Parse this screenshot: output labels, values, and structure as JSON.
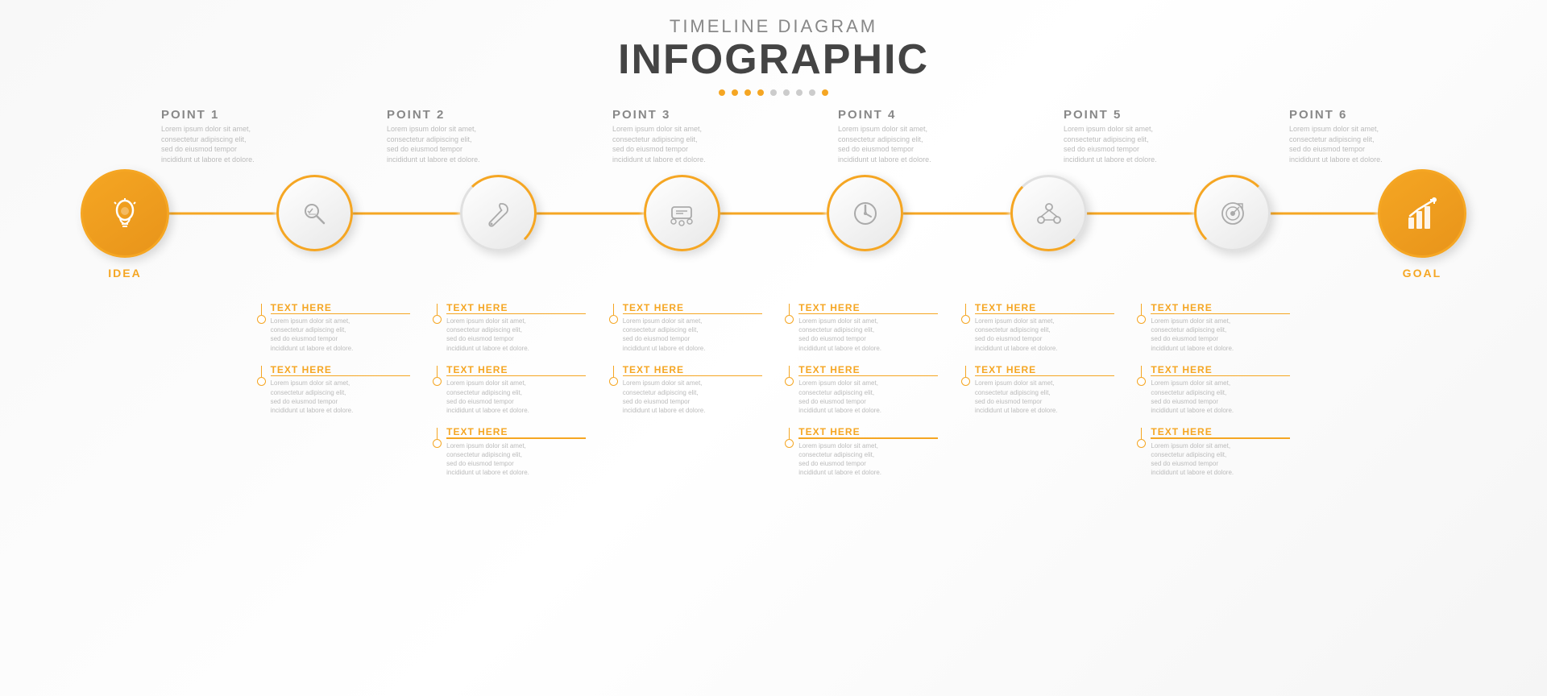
{
  "header": {
    "subtitle": "Timeline Diagram",
    "title": "INFOGRAPHIC",
    "dots": [
      {
        "type": "orange"
      },
      {
        "type": "orange"
      },
      {
        "type": "orange"
      },
      {
        "type": "orange"
      },
      {
        "type": "gray"
      },
      {
        "type": "gray"
      },
      {
        "type": "gray"
      },
      {
        "type": "gray"
      },
      {
        "type": "orange"
      }
    ]
  },
  "nodes": [
    {
      "id": "idea",
      "label": "IDEA",
      "type": "start"
    },
    {
      "id": "point1",
      "label": "POINT 1",
      "type": "mid"
    },
    {
      "id": "point2",
      "label": "POINT 2",
      "type": "mid"
    },
    {
      "id": "point3",
      "label": "POINT 3",
      "type": "mid"
    },
    {
      "id": "point4",
      "label": "POINT 4",
      "type": "mid"
    },
    {
      "id": "point5",
      "label": "POINT 5",
      "type": "mid"
    },
    {
      "id": "point6",
      "label": "POINT 6",
      "type": "mid"
    },
    {
      "id": "goal",
      "label": "GOAL",
      "type": "end"
    }
  ],
  "lorem": "Lorem ipsum dolor sit amet, consectetur adipiscing elit, sed do eiusmod tempor incididunt ut labore et dolore.",
  "lorem_short": "Lorem ipsum dolor sit amet, consectetur adipiscing elit, sed do eiusmod tempor incididunt ut labore et dolore.",
  "text_here": "TEXT HERE",
  "columns": [
    {
      "id": "col1",
      "items": [
        {
          "text": "TEXT HERE",
          "has_content": true
        },
        {
          "text": "TEXT HERE",
          "has_content": true
        }
      ]
    },
    {
      "id": "col2",
      "items": [
        {
          "text": "TEXT HERE",
          "has_content": true
        },
        {
          "text": "TEXT HERE",
          "has_content": true
        },
        {
          "text": "TEXT HERE",
          "has_content": true
        }
      ]
    },
    {
      "id": "col3",
      "items": [
        {
          "text": "TEXT HERE",
          "has_content": true
        },
        {
          "text": "TEXT HERE",
          "has_content": true
        }
      ]
    },
    {
      "id": "col4",
      "items": [
        {
          "text": "TEXT HERE",
          "has_content": true
        },
        {
          "text": "TEXT HERE",
          "has_content": true
        },
        {
          "text": "TEXT HERE",
          "has_content": true
        }
      ]
    },
    {
      "id": "col5",
      "items": [
        {
          "text": "TEXT HERE",
          "has_content": true
        },
        {
          "text": "TEXT HERE",
          "has_content": true
        }
      ]
    },
    {
      "id": "col6",
      "items": [
        {
          "text": "TEXT HERE",
          "has_content": true
        },
        {
          "text": "TEXT HERE",
          "has_content": true
        },
        {
          "text": "TEXT HERE",
          "has_content": true
        }
      ]
    }
  ],
  "colors": {
    "orange": "#f5a623",
    "text_dark": "#555555",
    "text_gray": "#999999",
    "text_light": "#bbbbbb"
  }
}
